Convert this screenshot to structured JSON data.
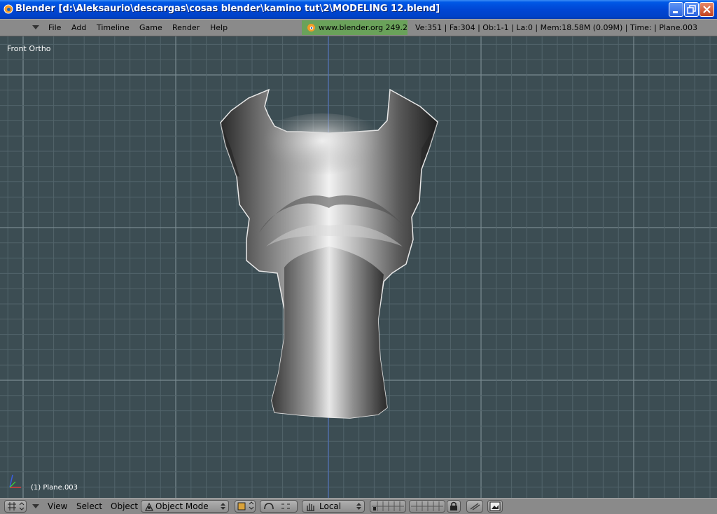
{
  "window": {
    "title": "Blender [d:\\Aleksaurio\\descargas\\cosas blender\\kamino tut\\2\\MODELING 12.blend]"
  },
  "header": {
    "menus": [
      "File",
      "Add",
      "Timeline",
      "Game",
      "Render",
      "Help"
    ],
    "url": "www.blender.org 249.2",
    "stats": "Ve:351 | Fa:304 | Ob:1-1 | La:0  | Mem:18.58M (0.09M)  | Time:  | Plane.003"
  },
  "viewport": {
    "view_label": "Front Ortho",
    "object_label": "(1) Plane.003"
  },
  "footer": {
    "menus": [
      "View",
      "Select",
      "Object"
    ],
    "mode": "Object Mode",
    "orientation": "Local"
  },
  "colors": {
    "viewport_bg": "#3c4d53",
    "grid_line": "#4f6068",
    "header_bg": "#8a8a8a",
    "url_bg": "#6aa25a",
    "titlebar": "#0046d4"
  },
  "icons": [
    "blender-app-icon",
    "minimize-icon",
    "maximize-icon",
    "close-icon",
    "blender-logo-icon",
    "axis-gizmo-icon",
    "window-type-icon",
    "draw-type-icon",
    "pivot-icon",
    "hand-icon",
    "layers-icon",
    "lock-icon",
    "render-icon"
  ]
}
